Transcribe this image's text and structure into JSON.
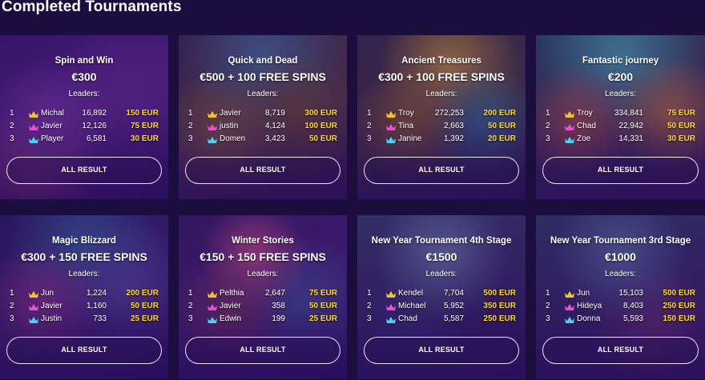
{
  "page": {
    "title": "Completed Tournaments"
  },
  "colors": {
    "background": "#1c0d3f",
    "prize_amount": "#ffd829",
    "crown_gold": "#f2c530",
    "crown_pink": "#ea4fd1",
    "crown_cyan": "#4ad2f0"
  },
  "icons": {
    "rank_1": "crown-gold-icon",
    "rank_2": "crown-pink-icon",
    "rank_3": "crown-cyan-icon"
  },
  "tournaments": [
    {
      "title": "Spin and Win",
      "prize": "€300",
      "leaders_label": "Leaders:",
      "button_label": "ALL RESULT",
      "leaders": [
        {
          "rank": "1",
          "name": "Michal",
          "score": "16,892",
          "prize": "150 EUR"
        },
        {
          "rank": "2",
          "name": "Javier",
          "score": "12,126",
          "prize": "75 EUR"
        },
        {
          "rank": "3",
          "name": "Player",
          "score": "6,581",
          "prize": "30 EUR"
        }
      ]
    },
    {
      "title": "Quick and Dead",
      "prize": "€500 + 100 FREE SPINS",
      "leaders_label": "Leaders:",
      "button_label": "ALL RESULT",
      "leaders": [
        {
          "rank": "1",
          "name": "Javier",
          "score": "8,719",
          "prize": "300 EUR"
        },
        {
          "rank": "2",
          "name": "justin",
          "score": "4,124",
          "prize": "100 EUR"
        },
        {
          "rank": "3",
          "name": "Domen",
          "score": "3,423",
          "prize": "50 EUR"
        }
      ]
    },
    {
      "title": "Ancient Treasures",
      "prize": "€300 + 100 FREE SPINS",
      "leaders_label": "Leaders:",
      "button_label": "ALL RESULT",
      "leaders": [
        {
          "rank": "1",
          "name": "Troy",
          "score": "272,253",
          "prize": "200 EUR"
        },
        {
          "rank": "2",
          "name": "Tina",
          "score": "2,663",
          "prize": "50 EUR"
        },
        {
          "rank": "3",
          "name": "Janine",
          "score": "1,392",
          "prize": "20 EUR"
        }
      ]
    },
    {
      "title": "Fantastic journey",
      "prize": "€200",
      "leaders_label": "Leaders:",
      "button_label": "ALL RESULT",
      "leaders": [
        {
          "rank": "1",
          "name": "Troy",
          "score": "334,841",
          "prize": "75 EUR"
        },
        {
          "rank": "2",
          "name": "Chad",
          "score": "22,942",
          "prize": "50 EUR"
        },
        {
          "rank": "3",
          "name": "Zoe",
          "score": "14,331",
          "prize": "30 EUR"
        }
      ]
    },
    {
      "title": "Magic Blizzard",
      "prize": "€300 + 150 FREE SPINS",
      "leaders_label": "Leaders:",
      "button_label": "ALL RESULT",
      "leaders": [
        {
          "rank": "1",
          "name": "Jun",
          "score": "1,224",
          "prize": "200 EUR"
        },
        {
          "rank": "2",
          "name": "Javier",
          "score": "1,160",
          "prize": "50 EUR"
        },
        {
          "rank": "3",
          "name": "Justin",
          "score": "733",
          "prize": "25 EUR"
        }
      ]
    },
    {
      "title": "Winter Stories",
      "prize": "€150 + 150 FREE SPINS",
      "leaders_label": "Leaders:",
      "button_label": "ALL RESULT",
      "leaders": [
        {
          "rank": "1",
          "name": "Pelthia",
          "score": "2,647",
          "prize": "75 EUR"
        },
        {
          "rank": "2",
          "name": "Javier",
          "score": "358",
          "prize": "50 EUR"
        },
        {
          "rank": "3",
          "name": "Edwin",
          "score": "199",
          "prize": "25 EUR"
        }
      ]
    },
    {
      "title": "New Year Tournament 4th Stage",
      "prize": "€1500",
      "leaders_label": "Leaders:",
      "button_label": "ALL RESULT",
      "leaders": [
        {
          "rank": "1",
          "name": "Kendel",
          "score": "7,704",
          "prize": "500 EUR"
        },
        {
          "rank": "2",
          "name": "Michael",
          "score": "5,952",
          "prize": "350 EUR"
        },
        {
          "rank": "3",
          "name": "Chad",
          "score": "5,587",
          "prize": "250 EUR"
        }
      ]
    },
    {
      "title": "New Year Tournament 3rd Stage",
      "prize": "€1000",
      "leaders_label": "Leaders:",
      "button_label": "ALL RESULT",
      "leaders": [
        {
          "rank": "1",
          "name": "Jun",
          "score": "15,103",
          "prize": "500 EUR"
        },
        {
          "rank": "2",
          "name": "Hideya",
          "score": "8,403",
          "prize": "250 EUR"
        },
        {
          "rank": "3",
          "name": "Donna",
          "score": "5,593",
          "prize": "150 EUR"
        }
      ]
    }
  ]
}
